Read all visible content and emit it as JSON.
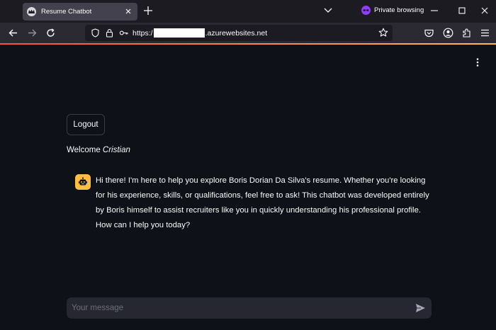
{
  "browser": {
    "tab": {
      "title": "Resume Chatbot",
      "favicon": "crown-icon"
    },
    "private_label": "Private browsing",
    "url": {
      "prefix": "https:/",
      "suffix": ".azurewebsites.net"
    },
    "colors": {
      "tabstrip": "#1c1b22",
      "toolbar": "#2b2a33",
      "private_purple": "#8f3ff7"
    }
  },
  "app": {
    "logout_label": "Logout",
    "welcome_prefix": "Welcome",
    "username": "Cristian",
    "assistant_message": "Hi there! I'm here to help you explore Boris Dorian Da Silva's resume. Whether you're looking for his experience, skills, or qualifications, feel free to ask! This chatbot was developed entirely by Boris himself to assist recruiters like you in quickly understanding his professional profile. How can I help you today?",
    "chat_input": {
      "placeholder": "Your message",
      "value": ""
    },
    "colors": {
      "background": "#0e1117",
      "accent": "#ff4b4b",
      "avatar": "#ffbd45",
      "input_bg": "#262730"
    }
  }
}
